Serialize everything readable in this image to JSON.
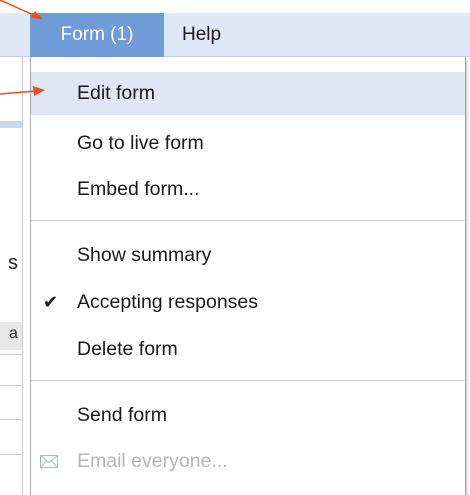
{
  "menubar": {
    "form_label": "Form (1)",
    "help_label": "Help"
  },
  "dropdown": {
    "items": [
      {
        "label": "Edit form"
      },
      {
        "label": "Go to live form"
      },
      {
        "label": "Embed form..."
      },
      {
        "label": "Show summary"
      },
      {
        "label": "Accepting responses",
        "checked": true
      },
      {
        "label": "Delete form"
      },
      {
        "label": "Send form"
      },
      {
        "label": "Email everyone...",
        "disabled": true
      }
    ]
  },
  "fragments": {
    "glyph_1": "s",
    "glyph_2": "a"
  },
  "colors": {
    "menubar_bg": "#dfe8f6",
    "active_menu": "#6f9bd6",
    "highlight": "#dfe6f4",
    "arrow": "#e8501f"
  }
}
